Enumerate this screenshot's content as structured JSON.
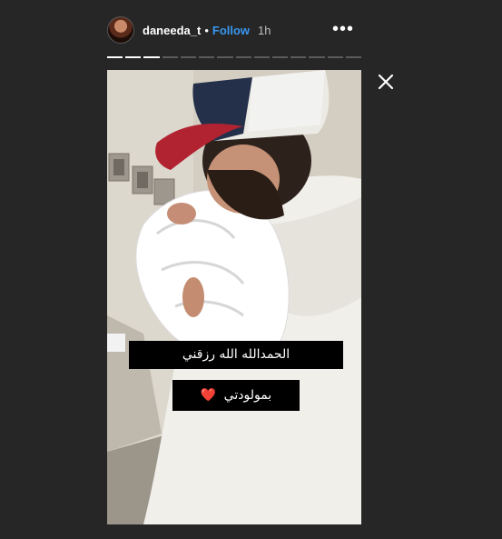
{
  "header": {
    "username": "daneeda_t",
    "separator": "•",
    "follow_label": "Follow",
    "time_ago": "1h",
    "more_icon": "more-options-icon"
  },
  "progress": {
    "total_segments": 14,
    "completed_segments": 3
  },
  "close_icon": "close-icon",
  "story": {
    "caption_line_1": "الحمدالله الله رزقني",
    "caption_line_2": "بمولودتي",
    "caption_emoji": "❤️"
  },
  "colors": {
    "background": "#262626",
    "follow": "#3897f0",
    "caption_bg": "#000000"
  }
}
